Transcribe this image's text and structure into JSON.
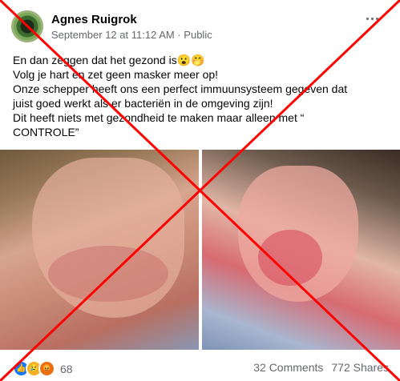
{
  "post": {
    "author": "Agnes Ruigrok",
    "date": "September 12 at 11:12 AM",
    "separator": "·",
    "audience": "Public",
    "lines": [
      "En dan zeggen dat het gezond is😮🤭",
      "Volg je hart en zet geen masker meer op!",
      "Onze schepper heeft ons een perfect immuunsysteem gegeven dat",
      "juist goed werkt als er bacteriën in de omgeving zijn!",
      "Dit heeft niets met gezondheid te maken maar alleen met “",
      "CONTROLE”"
    ]
  },
  "footer": {
    "reaction_count": "68",
    "comments": "32 Comments",
    "shares": "772 Shares"
  },
  "reactions": [
    {
      "name": "like-reaction",
      "glyph": "👍"
    },
    {
      "name": "sad-reaction",
      "glyph": "😢"
    },
    {
      "name": "angry-reaction",
      "glyph": "😡"
    }
  ],
  "colors": {
    "cross": "#ff0000",
    "secondary_text": "#65676b"
  }
}
